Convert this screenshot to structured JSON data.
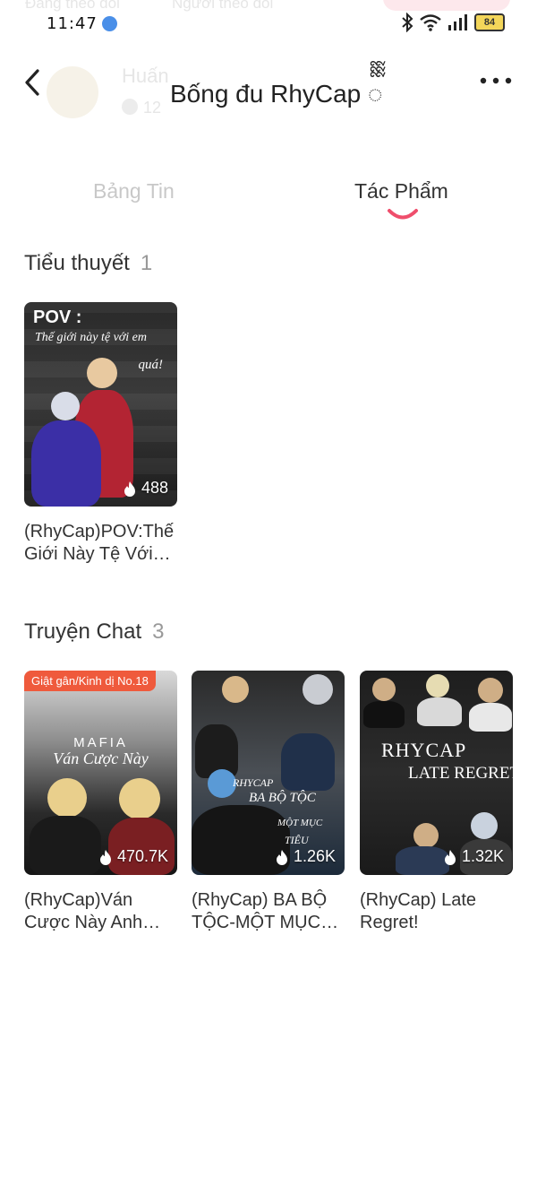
{
  "ghost": {
    "following": "Đang theo dõi",
    "followers": "Người theo dõi",
    "username": "Huấn",
    "stat": "12"
  },
  "status_bar": {
    "time": "11:47",
    "battery": "84"
  },
  "header": {
    "title": "Bống đu RhyCap ᢆ"
  },
  "tabs": [
    {
      "label": "Bảng Tin",
      "active": false
    },
    {
      "label": "Tác Phẩm",
      "active": true
    }
  ],
  "sections": {
    "novels": {
      "title": "Tiểu thuyết",
      "count": "1",
      "items": [
        {
          "title": "(RhyCap)POV:Thế Giới Này Tệ Với Em Quá!",
          "views": "488",
          "cover_heading": "POV :",
          "cover_line1": "Thế giới này tệ với em",
          "cover_line2": "quá!"
        }
      ]
    },
    "chat": {
      "title": "Truyện Chat",
      "count": "3",
      "items": [
        {
          "title": "(RhyCap)Ván Cược Này Anh Thua Không Rồi",
          "views": "470.7K",
          "badge": "Giật gân/Kinh dị No.18",
          "cover_heading": "MAFIA",
          "cover_line1": "Ván Cược Này"
        },
        {
          "title": "(RhyCap) BA BỘ TỘC-MỘT MỤC TIÊU",
          "views": "1.26K",
          "cover_line1": "RHYCAP",
          "cover_line2": "BA BỘ TỘC",
          "cover_line3": "MỘT MỤC",
          "cover_line4": "TIÊU"
        },
        {
          "title": "(RhyCap) Late Regret!",
          "views": "1.32K",
          "cover_heading": "RHYCAP",
          "cover_line1": "LATE REGRET"
        }
      ]
    }
  },
  "colors": {
    "accent": "#ef4e6c",
    "badge": "#ef5a3c",
    "inactive_tab": "#c8c8c8",
    "count": "#999999"
  },
  "icons": [
    "back-arrow-icon",
    "more-icon",
    "wifi-icon",
    "signal-icon",
    "bluetooth-icon",
    "battery-icon",
    "fire-icon"
  ]
}
